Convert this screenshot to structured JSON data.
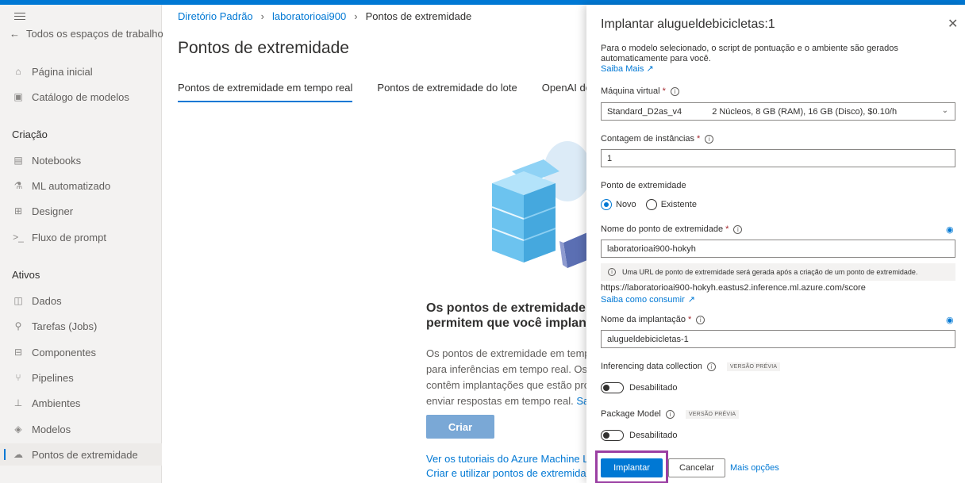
{
  "nav": {
    "back": "Todos os espaços de trabalho",
    "items_top": [
      {
        "label": "Página inicial",
        "icon": "home-icon"
      },
      {
        "label": "Catálogo de modelos",
        "icon": "catalog-icon"
      }
    ],
    "section_creation": "Criação",
    "items_creation": [
      {
        "label": "Notebooks",
        "icon": "notebook-icon"
      },
      {
        "label": "ML automatizado",
        "icon": "automl-icon"
      },
      {
        "label": "Designer",
        "icon": "designer-icon"
      },
      {
        "label": "Fluxo de prompt",
        "icon": "prompt-flow-icon"
      }
    ],
    "section_assets": "Ativos",
    "items_assets": [
      {
        "label": "Dados",
        "icon": "data-icon"
      },
      {
        "label": "Tarefas (Jobs)",
        "icon": "jobs-icon"
      },
      {
        "label": "Componentes",
        "icon": "components-icon"
      },
      {
        "label": "Pipelines",
        "icon": "pipelines-icon"
      },
      {
        "label": "Ambientes",
        "icon": "environments-icon"
      },
      {
        "label": "Modelos",
        "icon": "models-icon"
      },
      {
        "label": "Pontos de extremidade",
        "icon": "endpoints-icon"
      }
    ]
  },
  "breadcrumb": [
    "Diretório Padrão",
    "laboratorioai900",
    "Pontos de extremidade"
  ],
  "page_title": "Pontos de extremidade",
  "tabs": [
    "Pontos de extremidade em tempo real",
    "Pontos de extremidade do lote",
    "OpenAI do"
  ],
  "empty": {
    "title_line1": "Os pontos de extremidade c",
    "title_line2": "permitem que você implant",
    "desc_line1": "Os pontos de extremidade em temp",
    "desc_line2": "para inferências em tempo real. Os p",
    "desc_line3": "contêm implantações que estão pro",
    "desc_line4": "enviar respostas em tempo real.",
    "desc_link": "Saib",
    "create_button": "Criar",
    "link1": "Ver os tutoriais do Azure Machine Le",
    "link2": "Criar e utilizar pontos de extremidad"
  },
  "panel": {
    "title": "Implantar alugueldebicicletas:1",
    "description": "Para o modelo selecionado, o script de pontuação e o ambiente são gerados automaticamente para você.",
    "learn_more": "Saiba Mais",
    "vm_label": "Máquina virtual",
    "vm_value": "Standard_D2as_v4",
    "vm_specs": "2 Núcleos, 8 GB (RAM), 16 GB (Disco), $0.10/h",
    "instance_label": "Contagem de instâncias",
    "instance_value": "1",
    "endpoint_label": "Ponto de extremidade",
    "radio_new": "Novo",
    "radio_existing": "Existente",
    "endpoint_name_label": "Nome do ponto de extremidade",
    "endpoint_name_value": "laboratorioai900-hokyh",
    "info_text": "Uma URL de ponto de extremidade será gerada após a criação de um ponto de extremidade.",
    "url": "https://laboratorioai900-hokyh.eastus2.inference.ml.azure.com/score",
    "consume_link": "Saiba como consumir",
    "deployment_label": "Nome da implantação",
    "deployment_value": "alugueldebicicletas-1",
    "inferencing_label": "Inferencing data collection",
    "preview_badge": "VERSÃO PRÉVIA",
    "disabled": "Desabilitado",
    "package_label": "Package Model",
    "deploy_button": "Implantar",
    "cancel_button": "Cancelar",
    "more_options": "Mais opções"
  },
  "colors": {
    "accent": "#0078d4",
    "highlight": "#9b3fa3",
    "required": "#a4262c"
  }
}
